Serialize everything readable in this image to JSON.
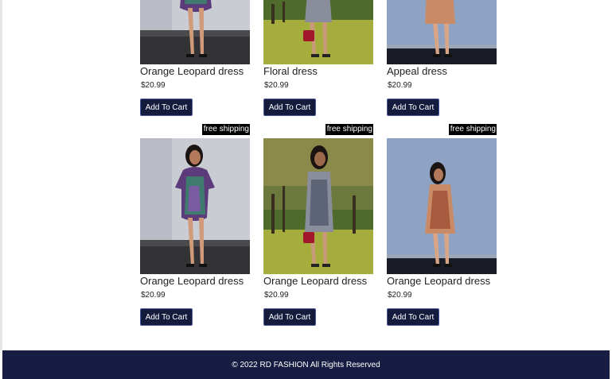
{
  "products": [
    {
      "name": "Orange Leopard dress",
      "price": "$20.99",
      "button": "Add To Cart",
      "badge": "",
      "scene": "studio-grey",
      "dress": "patterned-green"
    },
    {
      "name": "Floral dress",
      "price": "$20.99",
      "button": "Add To Cart",
      "badge": "",
      "scene": "park",
      "dress": "striped-grey"
    },
    {
      "name": "Appeal dress",
      "price": "$20.99",
      "button": "Add To Cart",
      "badge": "",
      "scene": "studio-blue",
      "dress": "patterned-orange"
    },
    {
      "name": "Orange Leopard dress",
      "price": "$20.99",
      "button": "Add To Cart",
      "badge": "free shipping",
      "scene": "studio-grey",
      "dress": "patterned-green"
    },
    {
      "name": "Orange Leopard dress",
      "price": "$20.99",
      "button": "Add To Cart",
      "badge": "free shipping",
      "scene": "park",
      "dress": "striped-grey"
    },
    {
      "name": "Orange Leopard dress",
      "price": "$20.99",
      "button": "Add To Cart",
      "badge": "free shipping",
      "scene": "studio-blue",
      "dress": "patterned-orange"
    }
  ],
  "footer": {
    "text": "© 2022 RD FASHION All Rights Reserved"
  },
  "colors": {
    "button_bg": "#141b3d",
    "footer_bg": "#171d42",
    "badge_bg": "#000000"
  }
}
